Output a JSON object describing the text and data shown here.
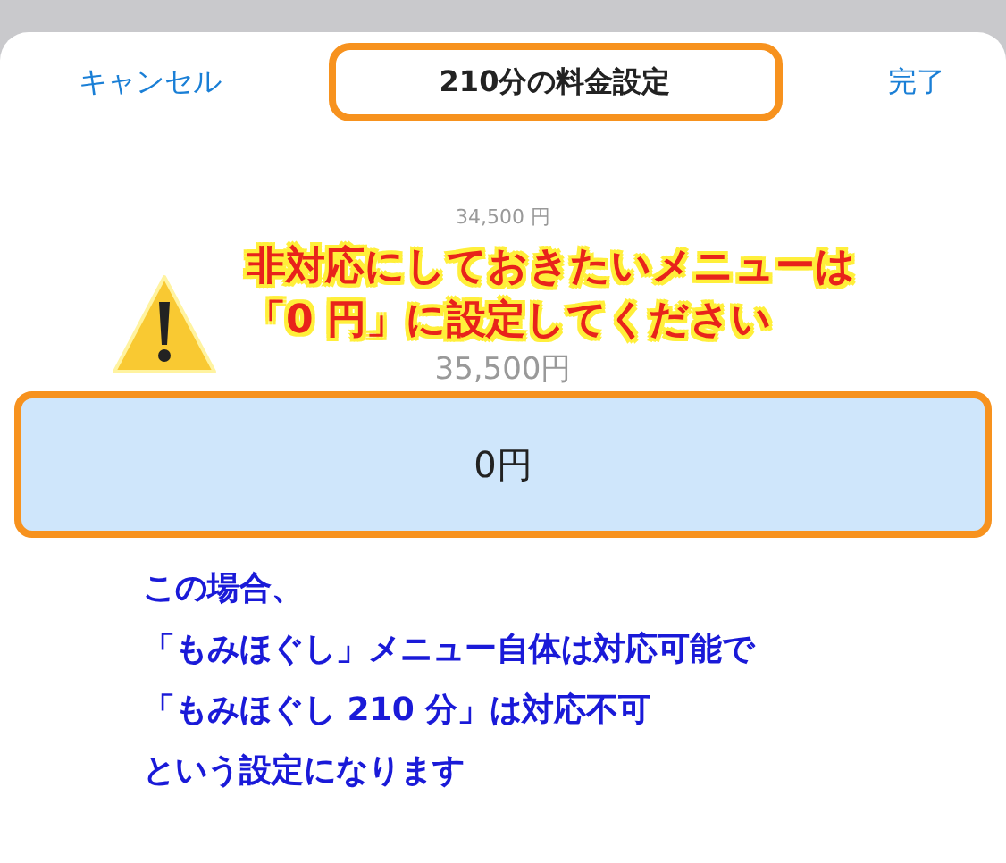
{
  "header": {
    "cancel": "キャンセル",
    "title": "210分の料金設定",
    "done": "完了"
  },
  "picker": {
    "options": [
      {
        "label": "34,500 円",
        "selected": false
      },
      {
        "label": "35,500円",
        "selected": false
      },
      {
        "label": "0円",
        "selected": true
      }
    ]
  },
  "warning": {
    "lines": [
      "非対応にしておきたいメニューは",
      "「0 円」に設定してください"
    ]
  },
  "note": {
    "lines": [
      "この場合、",
      "「もみほぐし」メニュー自体は対応可能で",
      "「もみほぐし 210 分」は対応不可",
      "という設定になります"
    ]
  }
}
